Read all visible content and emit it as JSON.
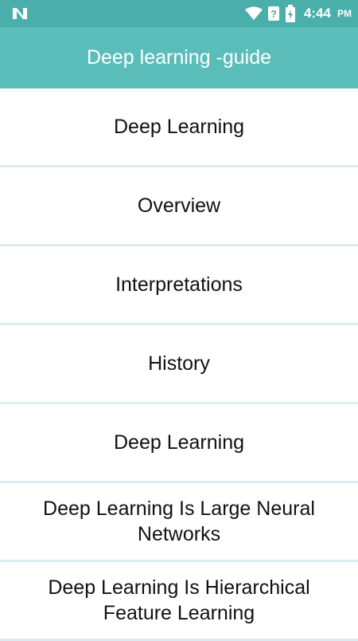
{
  "status_bar": {
    "time": "4:44",
    "ampm": "PM",
    "icons": [
      "n-logo-icon",
      "wifi-icon",
      "signal-icon",
      "battery-icon"
    ],
    "color": "#4aafaa"
  },
  "app_bar": {
    "title": "Deep learning -guide",
    "color": "#5bbdba"
  },
  "list": {
    "items": [
      {
        "label": "Deep Learning"
      },
      {
        "label": "Overview"
      },
      {
        "label": "Interpretations"
      },
      {
        "label": "History"
      },
      {
        "label": "Deep Learning"
      },
      {
        "label": "Deep Learning Is Large Neural Networks"
      },
      {
        "label": "Deep Learning Is Hierarchical Feature Learning"
      }
    ]
  }
}
